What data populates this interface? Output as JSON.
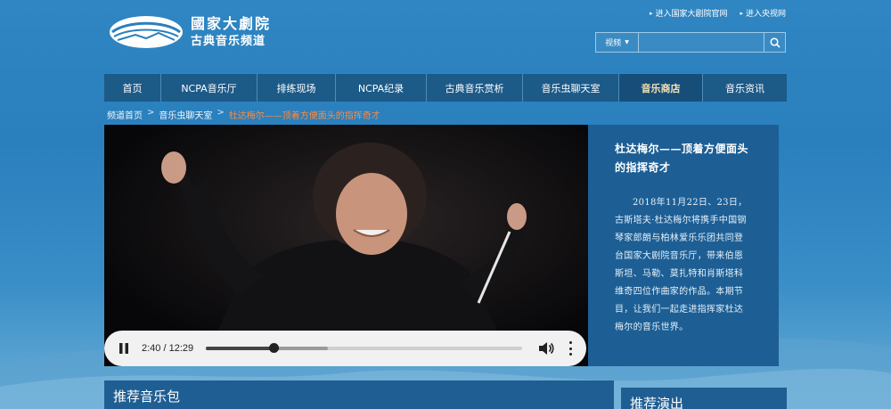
{
  "header": {
    "logo_title": "國家大劇院",
    "logo_subtitle": "古典音乐频道",
    "top_links": [
      "进入国家大剧院官网",
      "进入央视网"
    ]
  },
  "search": {
    "category": "视频",
    "placeholder": ""
  },
  "nav": {
    "items": [
      {
        "label": "首页"
      },
      {
        "label": "NCPA音乐厅"
      },
      {
        "label": "排练现场"
      },
      {
        "label": "NCPA纪录"
      },
      {
        "label": "古典音乐赏析"
      },
      {
        "label": "音乐虫聊天室"
      },
      {
        "label": "音乐商店"
      },
      {
        "label": "音乐资讯"
      }
    ],
    "active_index": 6
  },
  "breadcrumb": {
    "items": [
      "频道首页",
      "音乐虫聊天室"
    ],
    "current": "杜达梅尔——顶着方便面头的指挥奇才",
    "separator": ">"
  },
  "player": {
    "time_display": "2:40 / 12:29",
    "played_fraction": 0.214,
    "buffered_fraction": 0.386,
    "icons": [
      "pause-icon",
      "volume-icon",
      "more-vert-icon"
    ]
  },
  "info": {
    "title": "杜达梅尔——顶着方便面头的指挥奇才",
    "body": "2018年11月22日、23日，古斯塔夫·杜达梅尔将携手中国钢琴家郎朗与柏林爱乐乐团共同登台国家大剧院音乐厅，带来伯恩斯坦、马勒、莫扎特和肖斯塔科维奇四位作曲家的作品。本期节目，让我们一起走进指挥家杜达梅尔的音乐世界。"
  },
  "sections": {
    "left_title": "推荐音乐包",
    "right_title": "推荐演出"
  },
  "colors": {
    "nav_bg": "#1c5a88",
    "active_nav_text": "#f5e3b3",
    "breadcrumb_current": "#ff8a3d",
    "panel_bg": "#1d5f95"
  }
}
